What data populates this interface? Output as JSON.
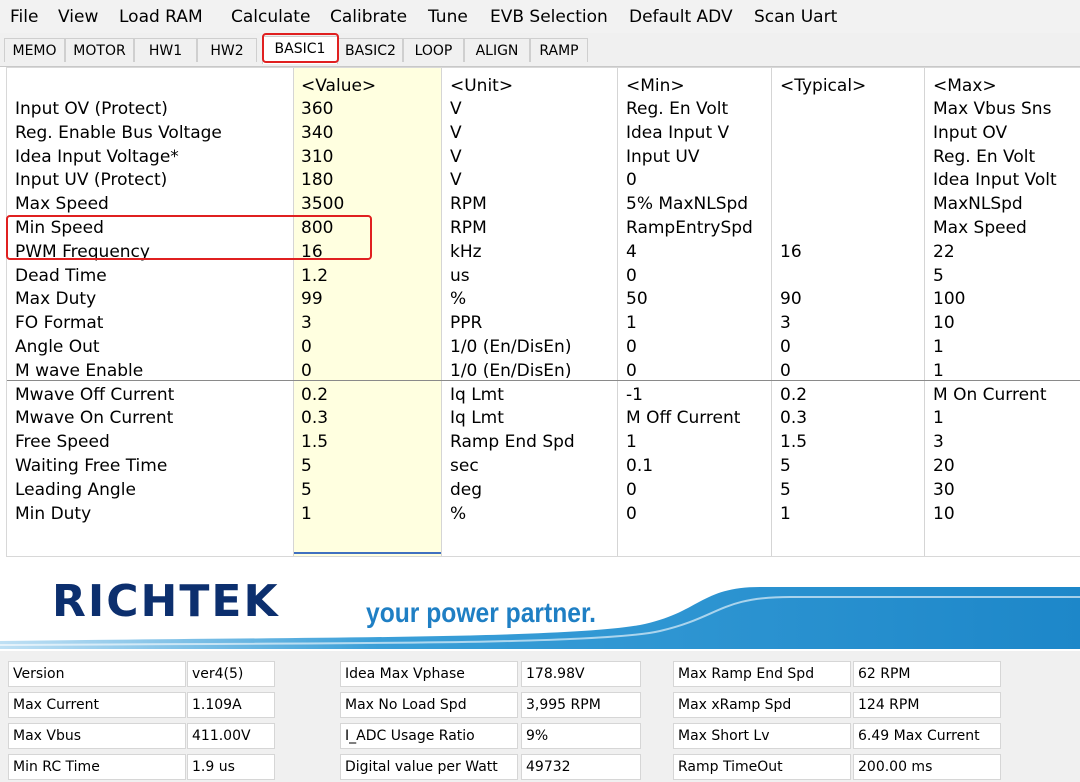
{
  "menu": [
    "File",
    "View",
    "Load RAM",
    "Calculate",
    "Calibrate",
    "Tune",
    "EVB Selection",
    "Default ADV",
    "Scan Uart"
  ],
  "tabs": [
    "MEMO",
    "MOTOR",
    "HW1",
    "HW2",
    "BASIC1",
    "BASIC2",
    "LOOP",
    "ALIGN",
    "RAMP"
  ],
  "active_tab": "BASIC1",
  "columns": [
    "<Value>",
    "<Unit>",
    "<Min>",
    "<Typical>",
    "<Max>"
  ],
  "rows": [
    [
      "Input OV (Protect)",
      "360",
      "V",
      "Reg. En Volt",
      "",
      "Max Vbus Sns"
    ],
    [
      "Reg. Enable Bus Voltage",
      "340",
      "V",
      "Idea Input V",
      "",
      "Input OV"
    ],
    [
      "Idea Input Voltage*",
      "310",
      "V",
      "Input UV",
      "",
      "Reg. En Volt"
    ],
    [
      "Input UV (Protect)",
      "180",
      "V",
      "0",
      "",
      "Idea Input Volt"
    ],
    [
      "Max Speed",
      "3500",
      "RPM",
      "5% MaxNLSpd",
      "",
      "MaxNLSpd"
    ],
    [
      "Min Speed",
      "800",
      "RPM",
      "RampEntrySpd",
      "",
      "Max Speed"
    ],
    [
      "PWM Frequency",
      "16",
      "kHz",
      "4",
      "16",
      "22"
    ],
    [
      "Dead Time",
      "1.2",
      "us",
      "0",
      "",
      "5"
    ],
    [
      "Max Duty",
      "99",
      "%",
      "50",
      "90",
      "100"
    ],
    [
      "FO Format",
      "3",
      "PPR",
      "1",
      "3",
      "10"
    ],
    [
      "Angle Out",
      "0",
      "1/0 (En/DisEn)",
      "0",
      "0",
      "1"
    ],
    [
      "M wave Enable",
      "0",
      "1/0 (En/DisEn)",
      "0",
      "0",
      "1"
    ],
    [
      "Mwave Off Current",
      "0.2",
      "Iq Lmt",
      "-1",
      "0.2",
      "M On Current"
    ],
    [
      "Mwave On Current",
      "0.3",
      "Iq Lmt",
      "M Off Current",
      "0.3",
      "1"
    ],
    [
      "Free Speed",
      "1.5",
      "Ramp End Spd",
      "1",
      "1.5",
      "3"
    ],
    [
      "Waiting Free Time",
      "5",
      "sec",
      "0.1",
      "5",
      "20"
    ],
    [
      "Leading Angle",
      "5",
      "deg",
      "0",
      "5",
      "30"
    ],
    [
      "Min Duty",
      "1",
      "%",
      "0",
      "1",
      "10"
    ]
  ],
  "brand": {
    "logo_text": "RICHTEK",
    "tagline": "your power partner.",
    "colors": {
      "logo": "#0c2f6e",
      "tagline": "#1f7fc4",
      "swoosh": "#3a9fd8"
    }
  },
  "status": [
    [
      [
        "Version",
        "ver4(5)"
      ],
      [
        "Idea Max Vphase",
        "178.98V"
      ],
      [
        "Max Ramp End Spd",
        "62 RPM"
      ]
    ],
    [
      [
        "Max Current",
        "1.109A"
      ],
      [
        "Max No Load Spd",
        "3,995 RPM"
      ],
      [
        "Max xRamp Spd",
        "124 RPM"
      ]
    ],
    [
      [
        "Max Vbus",
        "411.00V"
      ],
      [
        "I_ADC Usage Ratio",
        "9%"
      ],
      [
        "Max Short Lv",
        "6.49 Max Current"
      ]
    ],
    [
      [
        "Min RC Time",
        "1.9 us"
      ],
      [
        "Digital value per Watt",
        "49732"
      ],
      [
        "Ramp TimeOut",
        "200.00 ms"
      ]
    ]
  ],
  "highlight_color": "#e02020"
}
